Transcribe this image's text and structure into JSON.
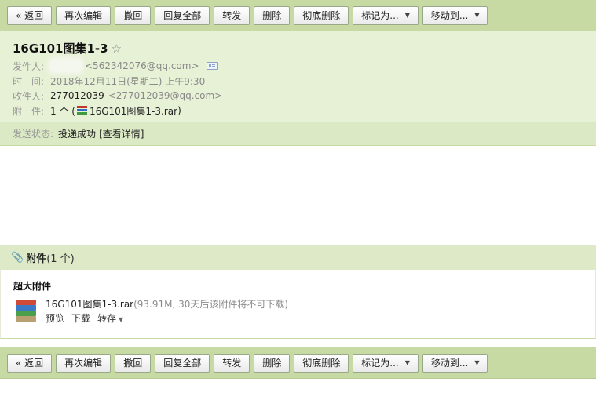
{
  "toolbar": {
    "back": "« 返回",
    "edit_again": "再次编辑",
    "recall": "撤回",
    "reply_all": "回复全部",
    "forward": "转发",
    "delete": "删除",
    "delete_permanently": "彻底删除",
    "mark_as": "标记为...",
    "move_to": "移动到..."
  },
  "header": {
    "subject": "16G101图集1-3",
    "star": "☆",
    "from_label": "发件人:",
    "from_email": "<562342076@qq.com>",
    "time_label": "时　间:",
    "time_value": "2018年12月11日(星期二) 上午9:30",
    "to_label": "收件人:",
    "to_name": "277012039",
    "to_email": "<277012039@qq.com>",
    "attach_label": "附　件:",
    "attach_prefix": "1 个 (",
    "attach_file": "16G101图集1-3.rar",
    "attach_suffix": ")",
    "status_label": "发送状态:",
    "status_value": "投递成功",
    "status_detail": "[查看详情]"
  },
  "attachments": {
    "heading": "附件",
    "count": "(1 个)",
    "section_label": "超大附件",
    "file_name": "16G101图集1-3.rar",
    "file_meta": "(93.91M, 30天后该附件将不可下载)",
    "preview": "预览",
    "download": "下载",
    "save_to": "转存"
  },
  "colors": {
    "toolbar_bg": "#c8daa4",
    "header_bg": "#e7f1d6",
    "status_bg": "#dbe9c4"
  }
}
